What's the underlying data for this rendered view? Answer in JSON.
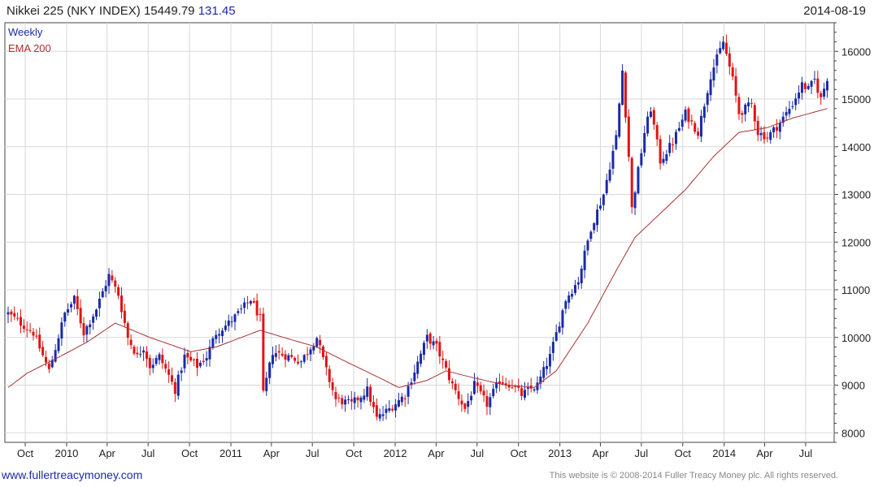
{
  "header": {
    "title": "Nikkei 225 (NKY INDEX)",
    "last_price": "15449.79",
    "change": "131.45",
    "date": "2014-08-19"
  },
  "legend": {
    "weekly": "Weekly",
    "ema": "EMA 200"
  },
  "footer": {
    "website": "www.fullertreacymoney.com",
    "copyright": "This website is © 2008-2014 Fuller Treacy Money plc. All rights reserved."
  },
  "colors": {
    "up": "#1a2aa8",
    "down": "#e01414",
    "ema": "#a83232",
    "grid": "#d8d8d8",
    "axis": "#444444"
  },
  "chart_data": {
    "type": "candlestick",
    "period": "weekly",
    "x_range": [
      "2009-08-24",
      "2014-08-19"
    ],
    "ylim": [
      7800,
      16600
    ],
    "y_ticks": [
      8000,
      9000,
      10000,
      11000,
      12000,
      13000,
      14000,
      15000,
      16000
    ],
    "x_ticks": [
      {
        "label": "Oct",
        "date": "2009-10-01"
      },
      {
        "label": "2010",
        "date": "2010-01-01"
      },
      {
        "label": "Apr",
        "date": "2010-04-01"
      },
      {
        "label": "Jul",
        "date": "2010-07-01"
      },
      {
        "label": "Oct",
        "date": "2010-10-01"
      },
      {
        "label": "2011",
        "date": "2011-01-01"
      },
      {
        "label": "Apr",
        "date": "2011-04-01"
      },
      {
        "label": "Jul",
        "date": "2011-07-01"
      },
      {
        "label": "Oct",
        "date": "2011-10-01"
      },
      {
        "label": "2012",
        "date": "2012-01-01"
      },
      {
        "label": "Apr",
        "date": "2012-04-01"
      },
      {
        "label": "Jul",
        "date": "2012-07-01"
      },
      {
        "label": "Oct",
        "date": "2012-10-01"
      },
      {
        "label": "2013",
        "date": "2013-01-01"
      },
      {
        "label": "Apr",
        "date": "2013-04-01"
      },
      {
        "label": "Jul",
        "date": "2013-07-01"
      },
      {
        "label": "Oct",
        "date": "2013-10-01"
      },
      {
        "label": "2014",
        "date": "2014-01-01"
      },
      {
        "label": "Apr",
        "date": "2014-04-01"
      },
      {
        "label": "Jul",
        "date": "2014-07-01"
      }
    ],
    "weekly_close_anchors": [
      [
        "2009-08-24",
        10500
      ],
      [
        "2009-09-21",
        10300
      ],
      [
        "2009-10-19",
        10100
      ],
      [
        "2009-11-23",
        9300
      ],
      [
        "2009-12-28",
        10500
      ],
      [
        "2010-01-18",
        10800
      ],
      [
        "2010-02-08",
        10100
      ],
      [
        "2010-03-08",
        10600
      ],
      [
        "2010-04-05",
        11300
      ],
      [
        "2010-04-26",
        10900
      ],
      [
        "2010-05-17",
        10000
      ],
      [
        "2010-06-07",
        9600
      ],
      [
        "2010-06-21",
        9800
      ],
      [
        "2010-07-05",
        9400
      ],
      [
        "2010-07-26",
        9600
      ],
      [
        "2010-08-16",
        9200
      ],
      [
        "2010-08-30",
        8900
      ],
      [
        "2010-09-20",
        9600
      ],
      [
        "2010-10-18",
        9400
      ],
      [
        "2010-11-08",
        9600
      ],
      [
        "2010-11-29",
        10100
      ],
      [
        "2010-12-27",
        10300
      ],
      [
        "2011-01-17",
        10500
      ],
      [
        "2011-02-14",
        10800
      ],
      [
        "2011-03-07",
        10400
      ],
      [
        "2011-03-14",
        8800
      ],
      [
        "2011-04-04",
        9700
      ],
      [
        "2011-05-09",
        9600
      ],
      [
        "2011-06-06",
        9500
      ],
      [
        "2011-06-27",
        9800
      ],
      [
        "2011-07-11",
        10000
      ],
      [
        "2011-08-01",
        9300
      ],
      [
        "2011-08-22",
        8700
      ],
      [
        "2011-09-26",
        8600
      ],
      [
        "2011-10-31",
        8900
      ],
      [
        "2011-11-21",
        8300
      ],
      [
        "2011-12-19",
        8500
      ],
      [
        "2012-01-23",
        8800
      ],
      [
        "2012-02-13",
        9300
      ],
      [
        "2012-03-12",
        10000
      ],
      [
        "2012-04-02",
        9800
      ],
      [
        "2012-05-07",
        9000
      ],
      [
        "2012-06-04",
        8500
      ],
      [
        "2012-06-25",
        9000
      ],
      [
        "2012-07-23",
        8600
      ],
      [
        "2012-08-20",
        9100
      ],
      [
        "2012-09-17",
        9000
      ],
      [
        "2012-10-08",
        8800
      ],
      [
        "2012-11-12",
        9000
      ],
      [
        "2012-12-10",
        9600
      ],
      [
        "2013-01-14",
        10800
      ],
      [
        "2013-02-11",
        11200
      ],
      [
        "2013-03-11",
        12300
      ],
      [
        "2013-04-08",
        13000
      ],
      [
        "2013-05-06",
        14200
      ],
      [
        "2013-05-20",
        15600
      ],
      [
        "2013-06-03",
        13800
      ],
      [
        "2013-06-10",
        12700
      ],
      [
        "2013-07-08",
        14300
      ],
      [
        "2013-07-22",
        14800
      ],
      [
        "2013-08-12",
        13700
      ],
      [
        "2013-09-09",
        14100
      ],
      [
        "2013-10-07",
        14700
      ],
      [
        "2013-11-04",
        14300
      ],
      [
        "2013-12-02",
        15500
      ],
      [
        "2013-12-30",
        16200
      ],
      [
        "2014-01-20",
        15400
      ],
      [
        "2014-02-03",
        14700
      ],
      [
        "2014-03-03",
        14900
      ],
      [
        "2014-03-17",
        14300
      ],
      [
        "2014-04-07",
        14200
      ],
      [
        "2014-05-05",
        14500
      ],
      [
        "2014-06-02",
        14900
      ],
      [
        "2014-06-23",
        15300
      ],
      [
        "2014-07-07",
        15200
      ],
      [
        "2014-07-21",
        15400
      ],
      [
        "2014-08-04",
        15000
      ],
      [
        "2014-08-18",
        15450
      ]
    ],
    "ema_anchors": [
      [
        "2009-08-24",
        8950
      ],
      [
        "2009-10-05",
        9250
      ],
      [
        "2009-12-07",
        9550
      ],
      [
        "2010-02-15",
        9900
      ],
      [
        "2010-04-19",
        10300
      ],
      [
        "2010-07-05",
        10000
      ],
      [
        "2010-10-04",
        9700
      ],
      [
        "2010-11-29",
        9800
      ],
      [
        "2011-03-07",
        10150
      ],
      [
        "2011-05-16",
        9950
      ],
      [
        "2011-07-11",
        9800
      ],
      [
        "2011-09-12",
        9500
      ],
      [
        "2011-11-28",
        9150
      ],
      [
        "2012-01-09",
        8950
      ],
      [
        "2012-03-12",
        9100
      ],
      [
        "2012-04-23",
        9300
      ],
      [
        "2012-06-25",
        9150
      ],
      [
        "2012-09-03",
        9000
      ],
      [
        "2012-11-05",
        8950
      ],
      [
        "2012-12-24",
        9300
      ],
      [
        "2013-03-04",
        10300
      ],
      [
        "2013-05-06",
        11400
      ],
      [
        "2013-06-17",
        12100
      ],
      [
        "2013-08-12",
        12600
      ],
      [
        "2013-10-07",
        13100
      ],
      [
        "2013-12-09",
        13800
      ],
      [
        "2014-02-03",
        14300
      ],
      [
        "2014-04-07",
        14400
      ],
      [
        "2014-06-02",
        14600
      ],
      [
        "2014-08-18",
        14800
      ]
    ]
  }
}
